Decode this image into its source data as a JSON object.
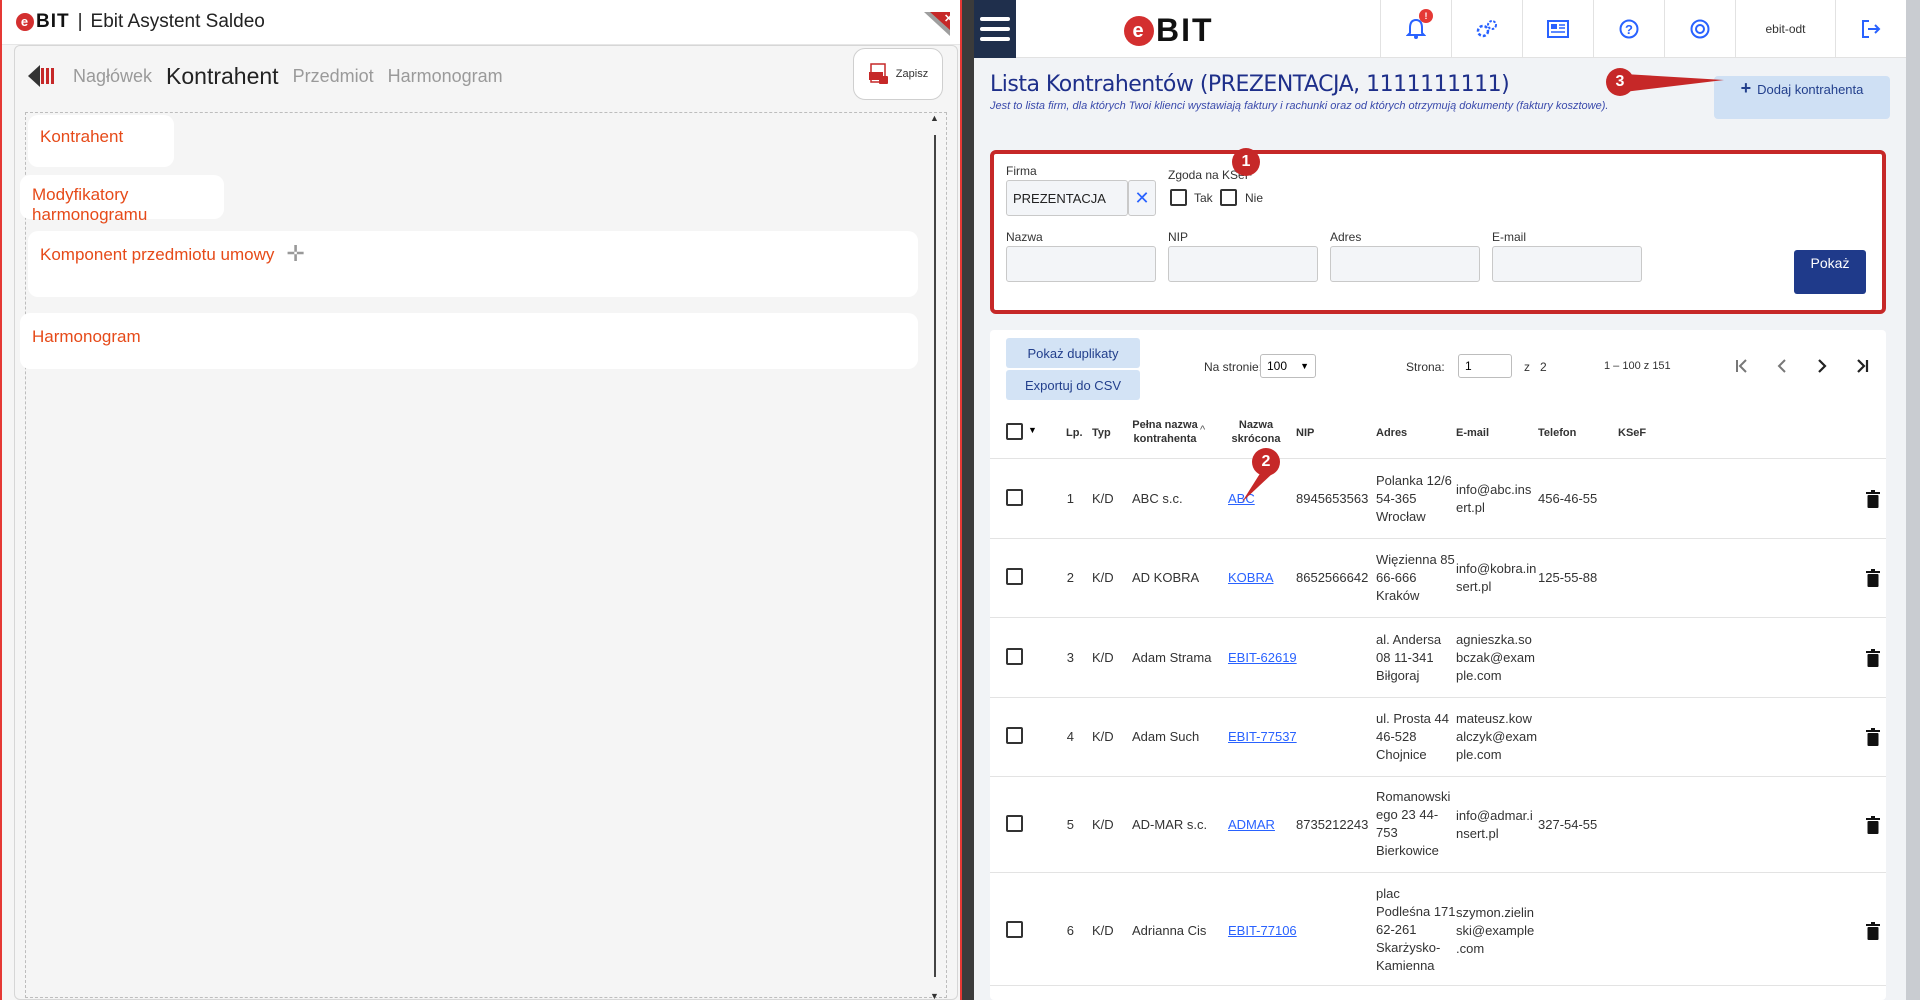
{
  "left": {
    "logo_text": "BIT",
    "title": "Ebit Asystent Saldeo",
    "tabs": [
      "Nagłówek",
      "Kontrahent",
      "Przedmiot",
      "Harmonogram"
    ],
    "save_label": "Zapisz",
    "sections": [
      "Kontrahent",
      "Modyfikatory harmonogramu",
      "Komponent przedmiotu umowy",
      "Harmonogram"
    ]
  },
  "right": {
    "logo_text": "BIT",
    "notification_count": "!",
    "user_label": "ebit-odt",
    "page_title": "Lista Kontrahentów (PREZENTACJA, 1111111111)",
    "page_desc": "Jest to lista firm, dla których Twoi klienci wystawiają faktury i rachunki oraz od których otrzymują dokumenty (faktury kosztowe).",
    "add_button": "Dodaj kontrahenta",
    "filters": {
      "firma_label": "Firma",
      "firma_value": "PREZENTACJA",
      "ksef_label": "Zgoda na KSeF",
      "tak_label": "Tak",
      "nie_label": "Nie",
      "nazwa_label": "Nazwa",
      "nip_label": "NIP",
      "adres_label": "Adres",
      "email_label": "E-mail",
      "show_button": "Pokaż"
    },
    "toolbar": {
      "duplicates_button": "Pokaż duplikaty",
      "export_button": "Exportuj do CSV",
      "per_page_label": "Na stronie:",
      "per_page_value": "100",
      "page_label": "Strona:",
      "page_value": "1",
      "page_of": "z",
      "page_total": "2",
      "range": "1 – 100 z 151"
    },
    "columns": {
      "lp": "Lp.",
      "typ": "Typ",
      "full_name_1": "Pełna nazwa",
      "full_name_2": "kontrahenta",
      "short_name_1": "Nazwa",
      "short_name_2": "skrócona",
      "nip": "NIP",
      "adres": "Adres",
      "email": "E-mail",
      "telefon": "Telefon",
      "ksef": "KSeF"
    },
    "rows": [
      {
        "lp": "1",
        "typ": "K/D",
        "name": "ABC s.c.",
        "short": "ABC",
        "nip": "8945653563",
        "addr1": "Polanka 12/6",
        "addr2": "54-365",
        "addr3": "Wrocław",
        "addr4": "",
        "addr5": "",
        "mail1": "info@abc.ins",
        "mail2": "ert.pl",
        "mail3": "",
        "phone": "456-46-55"
      },
      {
        "lp": "2",
        "typ": "K/D",
        "name": "AD KOBRA",
        "short": "KOBRA",
        "nip": "8652566642",
        "addr1": "Więzienna 85",
        "addr2": "66-666",
        "addr3": "Kraków",
        "addr4": "",
        "addr5": "",
        "mail1": "info@kobra.in",
        "mail2": "sert.pl",
        "mail3": "",
        "phone": "125-55-88"
      },
      {
        "lp": "3",
        "typ": "K/D",
        "name": "Adam Strama",
        "short": "EBIT-62619",
        "nip": "",
        "addr1": "al. Andersa",
        "addr2": "08 11-341",
        "addr3": "Biłgoraj",
        "addr4": "",
        "addr5": "",
        "mail1": "agnieszka.so",
        "mail2": "bczak@exam",
        "mail3": "ple.com",
        "phone": ""
      },
      {
        "lp": "4",
        "typ": "K/D",
        "name": "Adam Such",
        "short": "EBIT-77537",
        "nip": "",
        "addr1": "ul. Prosta 44",
        "addr2": "46-528",
        "addr3": "Chojnice",
        "addr4": "",
        "addr5": "",
        "mail1": "mateusz.kow",
        "mail2": "alczyk@exam",
        "mail3": "ple.com",
        "phone": ""
      },
      {
        "lp": "5",
        "typ": "K/D",
        "name": "AD-MAR s.c.",
        "short": "ADMAR",
        "nip": "8735212243",
        "addr1": "Romanowski",
        "addr2": "ego 23 44-",
        "addr3": "753",
        "addr4": "Bierkowice",
        "addr5": "",
        "mail1": "info@admar.i",
        "mail2": "nsert.pl",
        "mail3": "",
        "phone": "327-54-55"
      },
      {
        "lp": "6",
        "typ": "K/D",
        "name": "Adrianna Cis",
        "short": "EBIT-77106",
        "nip": "",
        "addr1": "plac",
        "addr2": "Podleśna 171",
        "addr3": "62-261",
        "addr4": "Skarżysko-",
        "addr5": "Kamienna",
        "mail1": "szymon.zielin",
        "mail2": "ski@example",
        "mail3": ".com",
        "phone": ""
      }
    ],
    "callouts": [
      "1",
      "2",
      "3"
    ]
  },
  "colors": {
    "accent_red": "#c62828",
    "brand_navy": "#1f2f4c",
    "title_blue": "#1e2f8a",
    "link_blue": "#2962ff",
    "section_orange": "#e64a19"
  }
}
